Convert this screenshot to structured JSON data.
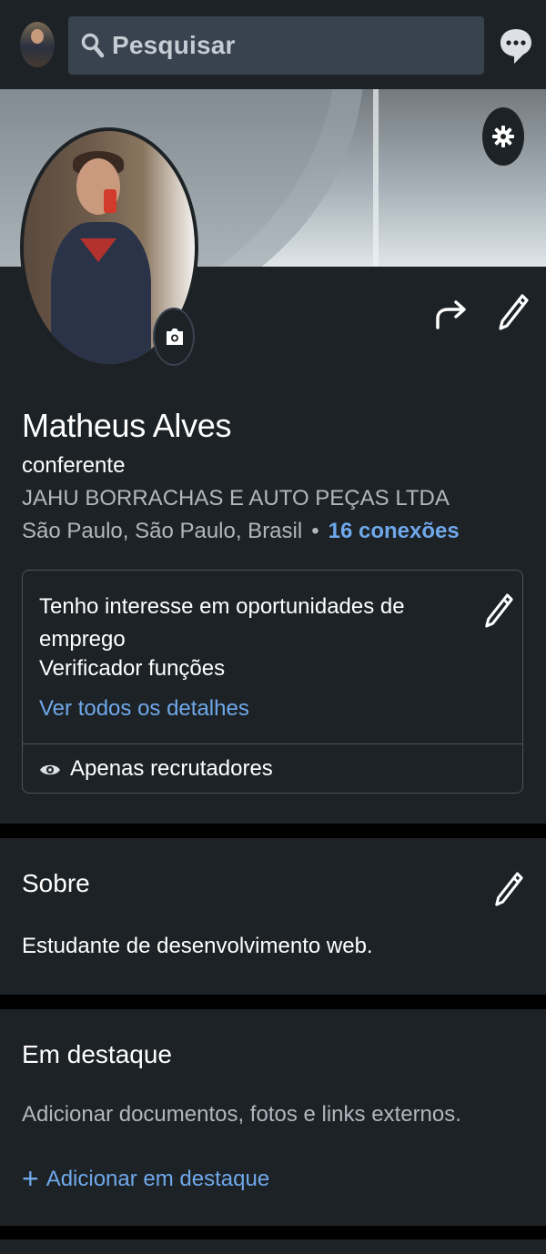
{
  "search": {
    "placeholder": "Pesquisar"
  },
  "profile": {
    "name": "Matheus Alves",
    "headline": "conferente",
    "company": "JAHU BORRACHAS E AUTO PEÇAS LTDA",
    "location": "São Paulo, São Paulo, Brasil",
    "separator": "•",
    "connections": "16 conexões"
  },
  "open_to_work": {
    "title": "Tenho interesse em oportunidades de emprego",
    "roles": "Verificador funções",
    "details_link": "Ver todos os detalhes",
    "visibility": "Apenas recrutadores"
  },
  "about": {
    "title": "Sobre",
    "text": "Estudante de desenvolvimento web."
  },
  "featured": {
    "title": "Em destaque",
    "description": "Adicionar documentos, fotos e links externos.",
    "add_plus": "+",
    "add_label": "Adicionar em destaque"
  },
  "colors": {
    "background": "#1d2226",
    "link": "#6fa8ea",
    "secondary_text": "#b0b7bf"
  }
}
